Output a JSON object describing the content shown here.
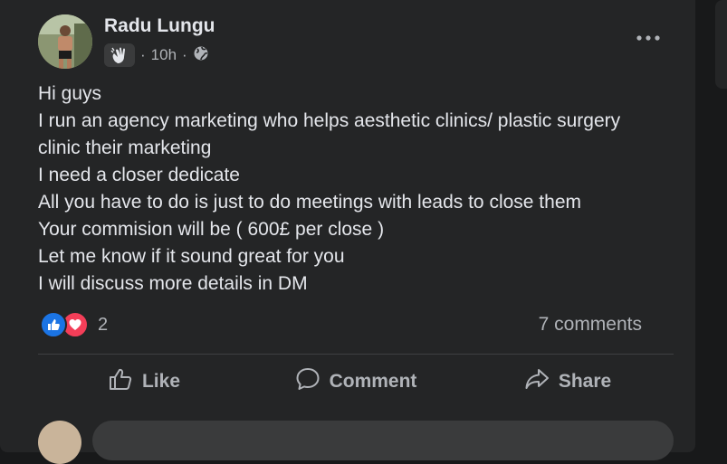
{
  "post": {
    "author": "Radu Lungu",
    "time": "10h",
    "separator": "·",
    "body_lines": [
      "Hi guys",
      "I run an agency marketing who helps aesthetic clinics/ plastic surgery",
      "clinic their marketing",
      "I need a closer dedicate",
      "All you have to do is just to do meetings with leads to close them",
      "Your commision will be ( 600£ per close )",
      "Let me know if it sound great for you",
      "I will discuss more details in DM"
    ]
  },
  "engagement": {
    "reaction_count": "2",
    "comments_text": "7 comments"
  },
  "actions": {
    "like": "Like",
    "comment": "Comment",
    "share": "Share"
  },
  "colors": {
    "background": "#18191a",
    "card": "#242526",
    "text_primary": "#e4e6eb",
    "text_secondary": "#b0b3b8",
    "like_blue": "#1b74e4",
    "love_red": "#f33e58"
  },
  "icons": [
    "wave-badge-icon",
    "globe-icon",
    "more-options-icon",
    "like-reaction-icon",
    "love-reaction-icon",
    "thumbs-up-icon",
    "comment-bubble-icon",
    "share-arrow-icon"
  ]
}
